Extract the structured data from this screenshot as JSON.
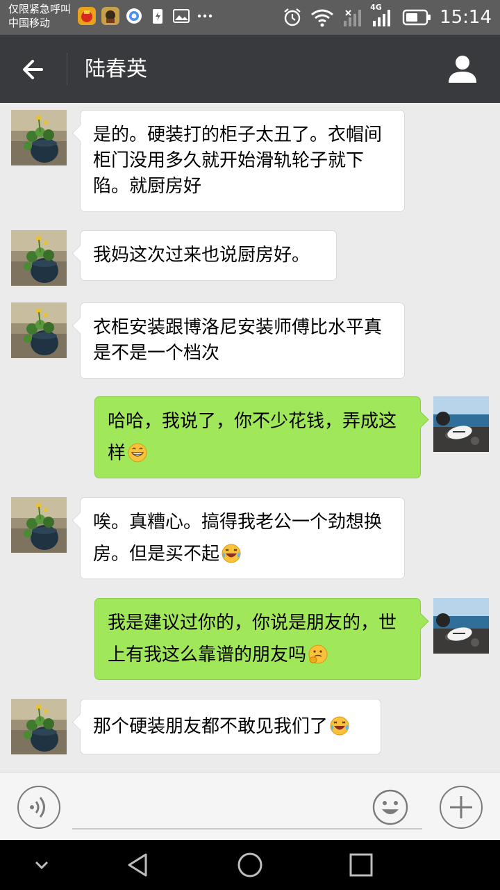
{
  "status_bar": {
    "carrier_line1": "仅限紧急呼叫",
    "carrier_line2": "中国移动",
    "network": "4G",
    "time": "15:14"
  },
  "header": {
    "title": "陆春英",
    "back_icon": "arrow-left-icon",
    "profile_icon": "person-icon"
  },
  "messages": [
    {
      "side": "in",
      "text": "是的。硬装打的柜子太丑了。衣帽间柜门没用多久就开始滑轨轮子就下陷。就厨房好"
    },
    {
      "side": "in",
      "text": "我妈这次过来也说厨房好。"
    },
    {
      "side": "in",
      "text": "衣柜安装跟博洛尼安装师傅比水平真是不是一个档次"
    },
    {
      "side": "out",
      "text": "哈哈，我说了，你不少花钱，弄成这样",
      "emoji": "grin-emoji"
    },
    {
      "side": "in",
      "text": "唉。真糟心。搞得我老公一个劲想换房。但是买不起",
      "emoji": "laugh-cry-emoji"
    },
    {
      "side": "out",
      "text": "我是建议过你的，你说是朋友的，世上有我这么靠谱的朋友吗",
      "emoji": "thinking-emoji"
    },
    {
      "side": "in",
      "text": "那个硬装朋友都不敢见我们了",
      "emoji": "laugh-cry-emoji"
    }
  ],
  "input_bar": {
    "voice_icon": "voice-icon",
    "emoji_icon": "smiley-icon",
    "plus_icon": "plus-icon",
    "input_value": ""
  },
  "nav_bar": {
    "icons": [
      "chevron-down-icon",
      "back-triangle-icon",
      "home-circle-icon",
      "recents-square-icon"
    ]
  },
  "colors": {
    "header_bg": "#393a3e",
    "status_bg": "#5d5d5d",
    "chat_bg": "#ebebeb",
    "out_bubble": "#a0e75a",
    "in_bubble": "#ffffff"
  }
}
